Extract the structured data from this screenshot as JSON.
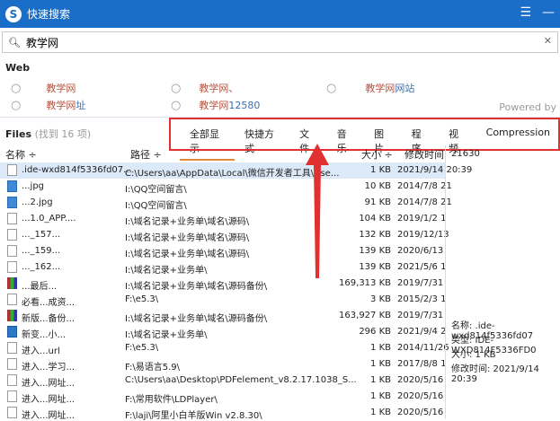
{
  "window": {
    "title": "快速搜索",
    "logo": "S",
    "controls": [
      "☰",
      "—"
    ]
  },
  "search": {
    "value": "教学网"
  },
  "web": {
    "label": "Web",
    "suggestions": [
      {
        "text": "教学网",
        "extra": ""
      },
      {
        "text": "教学网",
        "extra": "址"
      },
      {
        "text": "教学网、",
        "extra": ""
      },
      {
        "text": "教学网",
        "extra": "12580"
      },
      {
        "text": "教学网",
        "extra": "网站"
      }
    ],
    "powered": "Powered by"
  },
  "files": {
    "label": "Files",
    "count": "(找到 16 项)"
  },
  "tabs": [
    "全部显示",
    "快捷方式",
    "文件",
    "音乐",
    "图片",
    "程序",
    "视频",
    "Compression"
  ],
  "columns": {
    "name": "名称 ÷",
    "path": "路径 ÷",
    "size": "大小 ÷",
    "date": "修改时间"
  },
  "rows": [
    {
      "icon": "file",
      "name": ".ide-wxd814f5336fd07...",
      "path": "C:\\Users\\aa\\AppData\\Local\\微信开发者工具\\Use...",
      "size": "1 KB",
      "date": "2021/9/14 20:39"
    },
    {
      "icon": "jpg",
      "name": "...jpg",
      "path": "I:\\QQ空间留言\\",
      "size": "10 KB",
      "date": "2014/7/8 21"
    },
    {
      "icon": "jpg",
      "name": "...2.jpg",
      "path": "I:\\QQ空间留言\\",
      "size": "91 KB",
      "date": "2014/7/8 21"
    },
    {
      "icon": "file",
      "name": "...1.0_APP....",
      "path": "I:\\域名记录+业务单\\域名\\源码\\",
      "size": "104 KB",
      "date": "2019/1/2 1"
    },
    {
      "icon": "file",
      "name": "..._157...",
      "path": "I:\\域名记录+业务单\\域名\\源码\\",
      "size": "132 KB",
      "date": "2019/12/13"
    },
    {
      "icon": "file",
      "name": "..._159...",
      "path": "I:\\域名记录+业务单\\域名\\源码\\",
      "size": "139 KB",
      "date": "2020/6/13"
    },
    {
      "icon": "file",
      "name": "..._162...",
      "path": "I:\\域名记录+业务单\\",
      "size": "139 KB",
      "date": "2021/5/6 1"
    },
    {
      "icon": "rar",
      "name": "...最后...",
      "path": "I:\\域名记录+业务单\\域名\\源码备份\\",
      "size": "169,313 KB",
      "date": "2019/7/31"
    },
    {
      "icon": "file",
      "name": "必看...成资...",
      "path": "F:\\e5.3\\",
      "size": "3 KB",
      "date": "2015/2/3 1"
    },
    {
      "icon": "rar",
      "name": "新版...备份...",
      "path": "I:\\域名记录+业务单\\域名\\源码备份\\",
      "size": "163,927 KB",
      "date": "2019/7/31"
    },
    {
      "icon": "psd",
      "name": "新变...小...",
      "path": "I:\\域名记录+业务单\\",
      "size": "296 KB",
      "date": "2021/9/4 2"
    },
    {
      "icon": "file",
      "name": "进入...url",
      "path": "F:\\e5.3\\",
      "size": "1 KB",
      "date": "2014/11/26"
    },
    {
      "icon": "file",
      "name": "进入...学习...",
      "path": "F:\\易语言5.9\\",
      "size": "1 KB",
      "date": "2017/8/8 1"
    },
    {
      "icon": "file",
      "name": "进入...网址...",
      "path": "C:\\Users\\aa\\Desktop\\PDFelement_v8.2.17.1038_S...",
      "size": "1 KB",
      "date": "2020/5/16"
    },
    {
      "icon": "file",
      "name": "进入...网址...",
      "path": "F:\\常用软件\\LDPlayer\\",
      "size": "1 KB",
      "date": "2020/5/16"
    },
    {
      "icon": "file",
      "name": "进入...网址...",
      "path": "F:\\laji\\阿里小白羊版Win v2.8.30\\",
      "size": "1 KB",
      "date": "2020/5/16"
    }
  ],
  "preview": {
    "top": "21630",
    "name": "名称: .ide-wxd814f5336fd07",
    "type": "类型: IDE-WXD814F5336FD0",
    "size": "大小: 1 KB",
    "modified": "修改时间: 2021/9/14 20:39"
  }
}
